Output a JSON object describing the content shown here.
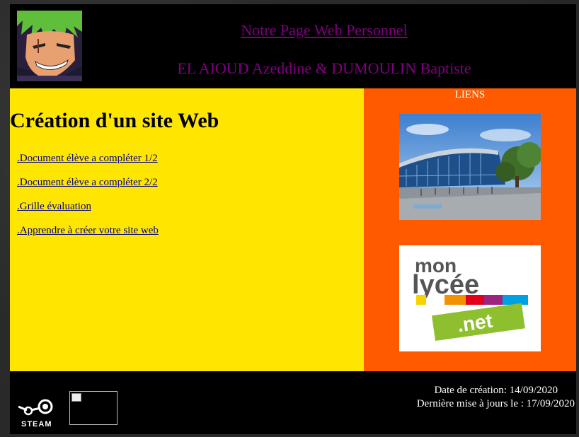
{
  "header": {
    "title": "Notre Page Web Personnel",
    "authors": "EL AIOUD Azeddine & DUMOULIN Baptiste",
    "avatar_icon": "anime-character-avatar"
  },
  "main": {
    "heading": "Création d'un site Web",
    "links": [
      ".Document élève a compléter 1/2",
      ".Document élève a compléter 2/2",
      ".Grille évaluation",
      ".Apprendre à créer votre site web"
    ]
  },
  "sidebar": {
    "title": "LIENS",
    "images": [
      {
        "name": "lycee-building-image"
      },
      {
        "name": "mon-lycee-net-logo",
        "text_top": "mon",
        "text_mid": "lycée",
        "text_bottom": ".net"
      }
    ]
  },
  "footer": {
    "steam_label": "STEAM",
    "creation_date": "Date de création: 14/09/2020",
    "last_update": "Dernière mise à jours le : 17/09/2020"
  },
  "colors": {
    "main_bg": "#ffe600",
    "sidebar_bg": "#ff5a00",
    "title_color": "#800080",
    "page_bg": "#000000"
  }
}
